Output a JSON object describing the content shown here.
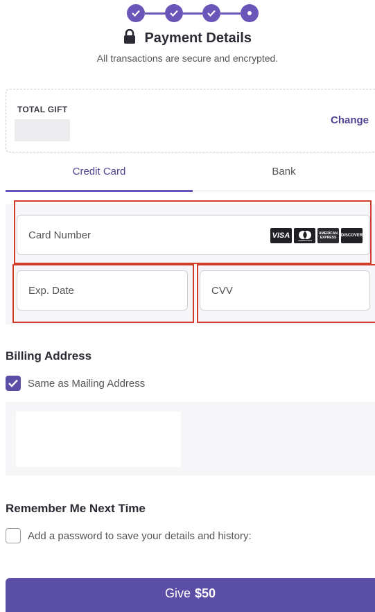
{
  "header": {
    "title": "Payment Details",
    "subtitle": "All transactions are secure and encrypted."
  },
  "stepper": {
    "steps_total": 4,
    "current_step": 4
  },
  "gift": {
    "label": "TOTAL GIFT",
    "change_label": "Change"
  },
  "tabs": [
    {
      "label": "Credit Card",
      "active": true
    },
    {
      "label": "Bank",
      "active": false
    }
  ],
  "card": {
    "number_placeholder": "Card Number",
    "exp_placeholder": "Exp. Date",
    "cvv_placeholder": "CVV",
    "brands": [
      "VISA",
      "mastercard",
      "AMERICAN EXPRESS",
      "DISCOVER"
    ]
  },
  "billing": {
    "title": "Billing Address",
    "same_as_mailing_label": "Same as Mailing Address",
    "same_as_mailing_checked": true
  },
  "remember": {
    "title": "Remember Me Next Time",
    "password_label": "Add a password to save your details and history:",
    "checked": false
  },
  "give_button": {
    "prefix": "Give",
    "amount": "$50"
  },
  "colors": {
    "accent": "#5b4ea6",
    "highlight": "#d23c2a",
    "link": "#4e4493"
  }
}
